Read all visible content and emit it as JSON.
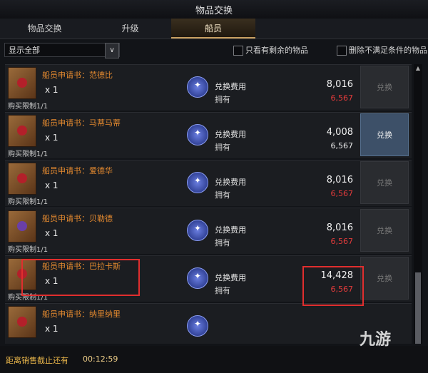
{
  "window": {
    "title": "物品交换"
  },
  "tabs": [
    {
      "label": "物品交换"
    },
    {
      "label": "升级"
    },
    {
      "label": "船员"
    }
  ],
  "filter": {
    "dropdown_value": "显示全部",
    "dropdown_arrow": "∨",
    "only_remaining_label": "只看有剩余的物品",
    "exclude_unmet_label": "删除不满足条件的物品"
  },
  "labels": {
    "cost": "兑换费用",
    "owned": "拥有",
    "exchange": "兑换"
  },
  "items": [
    {
      "name": "船员申请书：范德比",
      "qty": "x 1",
      "limit": "购买限制1/1",
      "cost": "8,016",
      "owned": "6,567",
      "owned_color": "red",
      "button_enabled": false
    },
    {
      "name": "船员申请书：马蒂马蒂",
      "qty": "x 1",
      "limit": "购买限制1/1",
      "cost": "4,008",
      "owned": "6,567",
      "owned_color": "white",
      "button_enabled": true
    },
    {
      "name": "船员申请书：爱德华",
      "qty": "x 1",
      "limit": "购买限制1/1",
      "cost": "8,016",
      "owned": "6,567",
      "owned_color": "red",
      "button_enabled": false
    },
    {
      "name": "船员申请书：贝勒德",
      "qty": "x 1",
      "limit": "购买限制1/1",
      "cost": "8,016",
      "owned": "6,567",
      "owned_color": "red",
      "button_enabled": false
    },
    {
      "name": "船员申请书：巴拉卡斯",
      "qty": "x 1",
      "limit": "购买限制1/1",
      "cost": "14,428",
      "owned": "6,567",
      "owned_color": "red",
      "button_enabled": false
    },
    {
      "name": "船员申请书：纳里纳里",
      "qty": "x 1",
      "limit": "",
      "cost": "",
      "owned": "",
      "owned_color": "white",
      "button_enabled": false
    }
  ],
  "footer": {
    "deadline_label": "距离销售截止还有",
    "deadline_time": "00:12:59"
  },
  "watermark": "九游",
  "colors": {
    "item_name": "#e58a2f",
    "insufficient": "#e33b3b",
    "active_tab_accent": "#c9a061",
    "enabled_button": "#3d5068",
    "highlight_box": "#e02e2e"
  }
}
